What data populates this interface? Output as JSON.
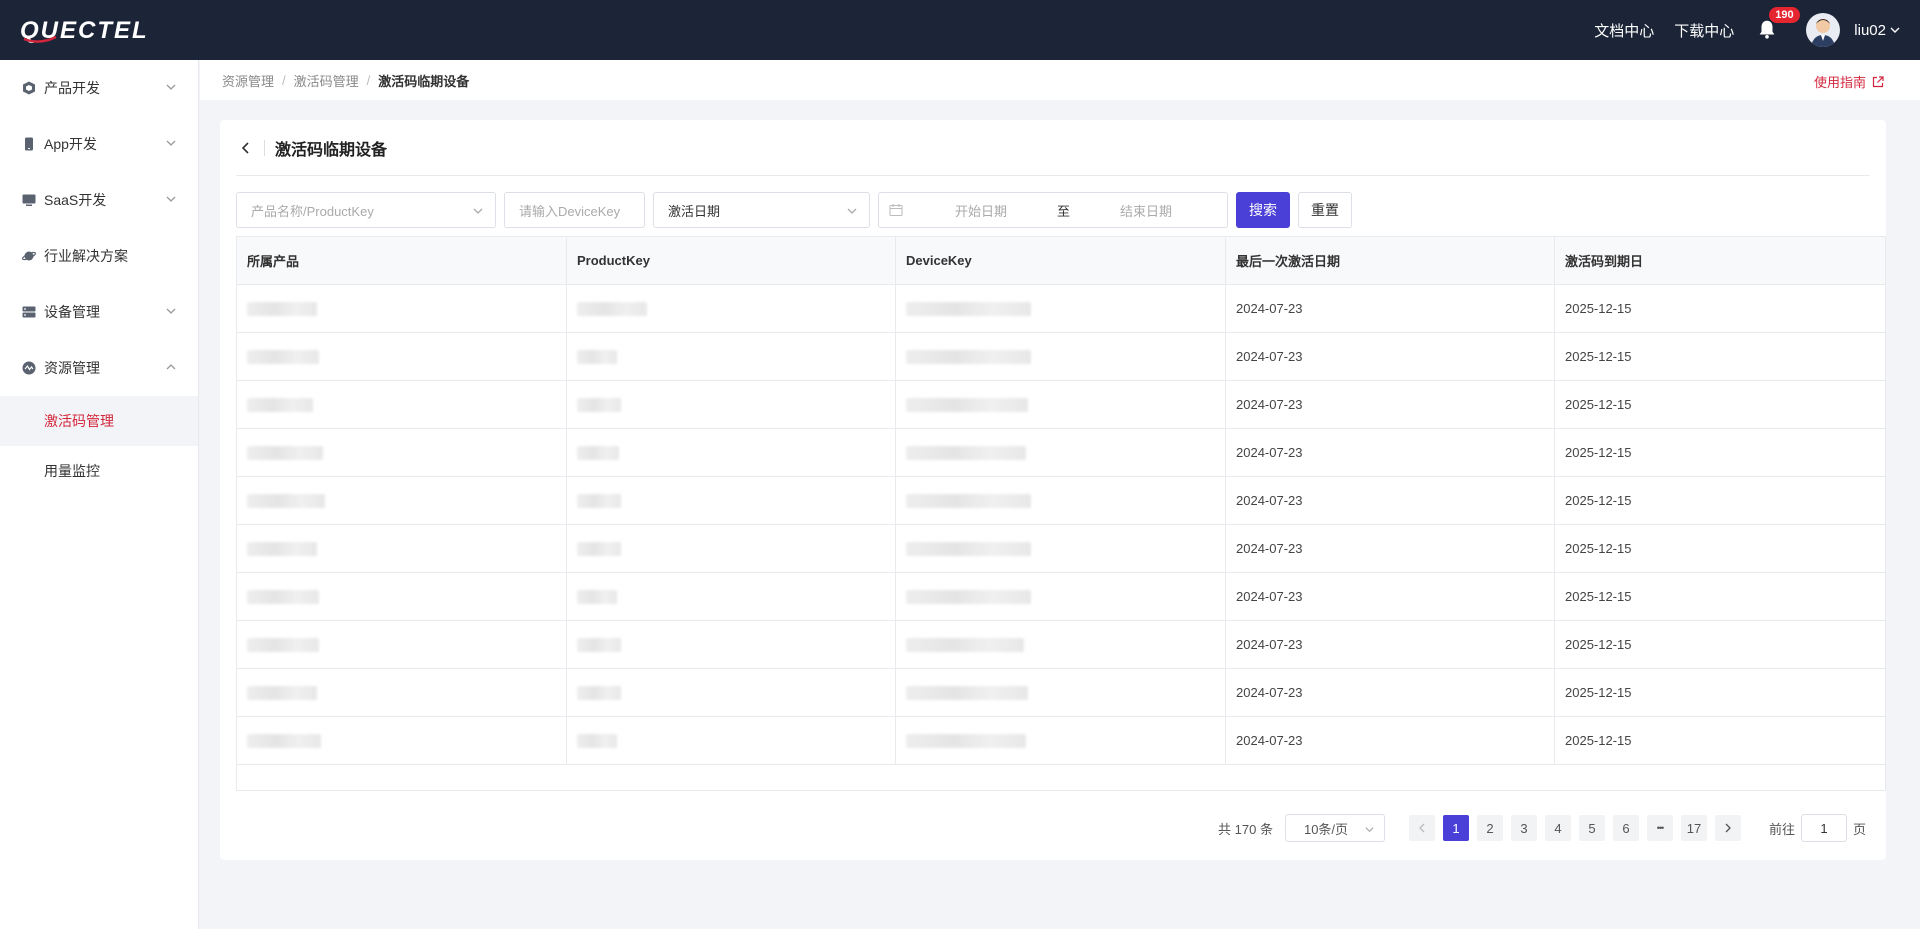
{
  "brand": {
    "logo_text": "QUECTEL",
    "accent": "#d3263c",
    "primary": "#4a3fd6",
    "topbar_bg": "#1b2537"
  },
  "topbar": {
    "links": [
      "文档中心",
      "下载中心"
    ],
    "notification_count": "190",
    "username": "liu02"
  },
  "sidebar": {
    "items": [
      {
        "label": "产品开发",
        "icon": "cube-icon",
        "expandable": true
      },
      {
        "label": "App开发",
        "icon": "phone-icon",
        "expandable": true
      },
      {
        "label": "SaaS开发",
        "icon": "monitor-icon",
        "expandable": true
      },
      {
        "label": "行业解决方案",
        "icon": "planet-icon",
        "expandable": false
      },
      {
        "label": "设备管理",
        "icon": "server-icon",
        "expandable": true
      },
      {
        "label": "资源管理",
        "icon": "resource-icon",
        "expandable": true,
        "expanded": true
      }
    ],
    "sub_items": [
      {
        "label": "激活码管理",
        "active": true
      },
      {
        "label": "用量监控",
        "active": false
      }
    ]
  },
  "breadcrumb": [
    "资源管理",
    "激活码管理",
    "激活码临期设备"
  ],
  "guide_label": "使用指南",
  "page_title": "激活码临期设备",
  "filters": {
    "product_placeholder": "产品名称/ProductKey",
    "devicekey_placeholder": "请输入DeviceKey",
    "date_type": "激活日期",
    "start_placeholder": "开始日期",
    "range_sep": "至",
    "end_placeholder": "结束日期",
    "search_label": "搜索",
    "reset_label": "重置"
  },
  "table": {
    "columns": [
      "所属产品",
      "ProductKey",
      "DeviceKey",
      "最后一次激活日期",
      "激活码到期日"
    ],
    "rows": [
      {
        "last_activation": "2024-07-23",
        "expiry": "2025-12-15"
      },
      {
        "last_activation": "2024-07-23",
        "expiry": "2025-12-15"
      },
      {
        "last_activation": "2024-07-23",
        "expiry": "2025-12-15"
      },
      {
        "last_activation": "2024-07-23",
        "expiry": "2025-12-15"
      },
      {
        "last_activation": "2024-07-23",
        "expiry": "2025-12-15"
      },
      {
        "last_activation": "2024-07-23",
        "expiry": "2025-12-15"
      },
      {
        "last_activation": "2024-07-23",
        "expiry": "2025-12-15"
      },
      {
        "last_activation": "2024-07-23",
        "expiry": "2025-12-15"
      },
      {
        "last_activation": "2024-07-23",
        "expiry": "2025-12-15"
      },
      {
        "last_activation": "2024-07-23",
        "expiry": "2025-12-15"
      }
    ]
  },
  "pagination": {
    "total_text": "共 170 条",
    "page_size": "10条/页",
    "pages": [
      "1",
      "2",
      "3",
      "4",
      "5",
      "6"
    ],
    "ellipsis": "•••",
    "last_page": "17",
    "current": "1",
    "goto_prefix": "前往",
    "goto_value": "1",
    "goto_suffix": "页"
  }
}
